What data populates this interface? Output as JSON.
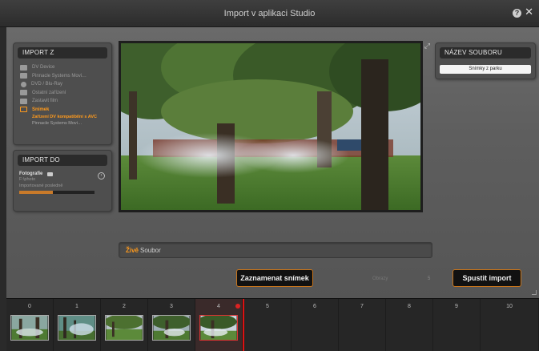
{
  "window": {
    "title": "Import v aplikaci Studio"
  },
  "import_from": {
    "header": "IMPORT Z",
    "sources": [
      {
        "label": "DV Device",
        "icon": "camcorder-icon",
        "active": false
      },
      {
        "label": "Pinnacle Systems Movi…",
        "icon": "webcam-icon",
        "active": false
      },
      {
        "label": "DVD / Blu-Ray",
        "icon": "disc-icon",
        "active": false
      },
      {
        "label": "Ostatní zařízení",
        "icon": "folder-icon",
        "active": false
      },
      {
        "label": "Zastavit film",
        "icon": "film-icon",
        "active": false
      },
      {
        "label": "Snímek",
        "icon": "camera-icon",
        "active": true
      }
    ],
    "sub_items": [
      {
        "label": "Zařízení DV kompatibilní s AVC",
        "active": true
      },
      {
        "label": "Pinnacle Systems Movi…",
        "active": false
      }
    ]
  },
  "import_to": {
    "header": "IMPORT DO",
    "category": "Fotografie",
    "line1": "F:\\photo",
    "line2": "Importované posledně",
    "progress": 0.45
  },
  "file_name": {
    "header": "NÁZEV SOUBORU",
    "value": "Snímky z parku"
  },
  "live_bar": {
    "live_label": "Živě",
    "file_label": "Soubor"
  },
  "actions": {
    "capture_label": "Zaznamenat snímek",
    "frames_label": "Obrazy",
    "frames_value": "5",
    "start_label": "Spustit import"
  },
  "timeline": {
    "slots": [
      "0",
      "1",
      "2",
      "3",
      "4",
      "5",
      "6",
      "7",
      "8",
      "9",
      "10"
    ],
    "active_slot": "4"
  },
  "colors": {
    "accent": "#ff9a1c",
    "button_border": "#c8741a",
    "marker": "#dd2222"
  }
}
